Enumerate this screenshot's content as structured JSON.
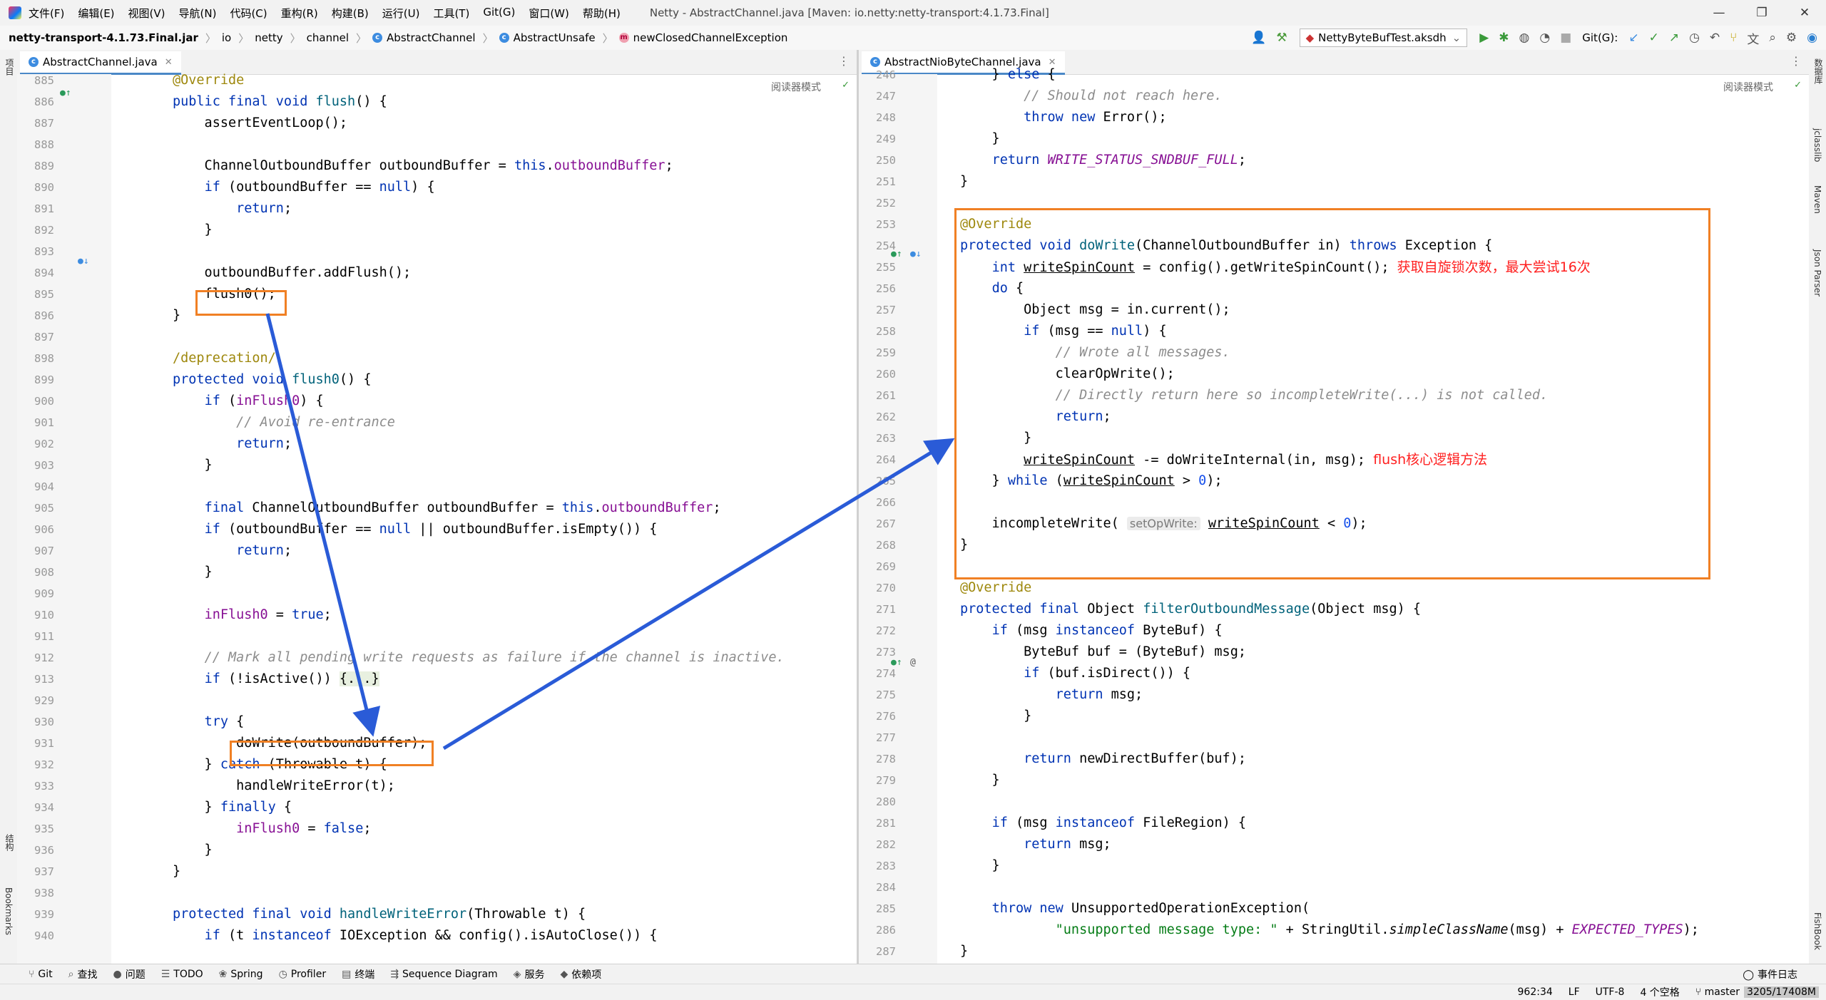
{
  "menu": [
    "文件(F)",
    "编辑(E)",
    "视图(V)",
    "导航(N)",
    "代码(C)",
    "重构(R)",
    "构建(B)",
    "运行(U)",
    "工具(T)",
    "Git(G)",
    "窗口(W)",
    "帮助(H)"
  ],
  "window_title": "Netty - AbstractChannel.java [Maven: io.netty:netty-transport:4.1.73.Final]",
  "window_controls": [
    "—",
    "❐",
    "✕"
  ],
  "breadcrumb": {
    "jar": "netty-transport-4.1.73.Final.jar",
    "pkg1": "io",
    "pkg2": "netty",
    "pkg3": "channel",
    "cls1": "AbstractChannel",
    "cls2": "AbstractUnsafe",
    "method": "newClosedChannelException"
  },
  "toolbar": {
    "run_config": "NettyByteBufTest.aksdh",
    "git_label": "Git(G):"
  },
  "left_strip": [
    "项目",
    "结构",
    "Bookmarks"
  ],
  "right_strip": [
    "数据库",
    "jclasslib",
    "Maven",
    "Json Parser",
    "FishBook"
  ],
  "left_pane": {
    "tab": "AbstractChannel.java",
    "reader_mode": "阅读器模式",
    "lines": [
      {
        "n": "885",
        "h": "<span class=\"an\">@Override</span>"
      },
      {
        "n": "886",
        "h": "<span class=\"kw\">public final void</span> <span style=\"color:#00627a\">flush</span>() {"
      },
      {
        "n": "887",
        "h": "    assertEventLoop();"
      },
      {
        "n": "888",
        "h": ""
      },
      {
        "n": "889",
        "h": "    ChannelOutboundBuffer outboundBuffer = <span class=\"kw\">this</span>.<span class=\"fd\">outboundBuffer</span>;"
      },
      {
        "n": "890",
        "h": "    <span class=\"kw\">if</span> (outboundBuffer == <span class=\"kw\">null</span>) {"
      },
      {
        "n": "891",
        "h": "        <span class=\"kw\">return</span>;"
      },
      {
        "n": "892",
        "h": "    }"
      },
      {
        "n": "893",
        "h": ""
      },
      {
        "n": "894",
        "h": "    outboundBuffer.addFlush();"
      },
      {
        "n": "895",
        "h": "    flush0();"
      },
      {
        "n": "896",
        "h": "}"
      },
      {
        "n": "897",
        "h": ""
      },
      {
        "n": "898",
        "h": "<span class=\"an\">/deprecation/</span>"
      },
      {
        "n": "899",
        "h": "<span class=\"kw\">protected void</span> <span style=\"color:#00627a\">flush0</span>() {"
      },
      {
        "n": "900",
        "h": "    <span class=\"kw\">if</span> (<span class=\"fd\">inFlush0</span>) {"
      },
      {
        "n": "901",
        "h": "        <span class=\"cm\">// Avoid re-entrance</span>"
      },
      {
        "n": "902",
        "h": "        <span class=\"kw\">return</span>;"
      },
      {
        "n": "903",
        "h": "    }"
      },
      {
        "n": "904",
        "h": ""
      },
      {
        "n": "905",
        "h": "    <span class=\"kw\">final</span> ChannelOutboundBuffer outboundBuffer = <span class=\"kw\">this</span>.<span class=\"fd\">outboundBuffer</span>;"
      },
      {
        "n": "906",
        "h": "    <span class=\"kw\">if</span> (outboundBuffer == <span class=\"kw\">null</span> || outboundBuffer.isEmpty()) {"
      },
      {
        "n": "907",
        "h": "        <span class=\"kw\">return</span>;"
      },
      {
        "n": "908",
        "h": "    }"
      },
      {
        "n": "909",
        "h": ""
      },
      {
        "n": "910",
        "h": "    <span class=\"fd\">inFlush0</span> = <span class=\"kw\">true</span>;"
      },
      {
        "n": "911",
        "h": ""
      },
      {
        "n": "912",
        "h": "    <span class=\"cm\">// Mark all pending write requests as failure if the channel is inactive.</span>"
      },
      {
        "n": "913",
        "h": "    <span class=\"kw\">if</span> (!isActive()) <span style=\"background:#e8f0e0\">{...}</span>"
      },
      {
        "n": "929",
        "h": ""
      },
      {
        "n": "930",
        "h": "    <span class=\"kw\">try</span> {"
      },
      {
        "n": "931",
        "h": "        doWrite(outboundBuffer);"
      },
      {
        "n": "932",
        "h": "    } <span class=\"kw\">catch</span> (Throwable t) {"
      },
      {
        "n": "933",
        "h": "        handleWriteError(t);"
      },
      {
        "n": "934",
        "h": "    } <span class=\"kw\">finally</span> {"
      },
      {
        "n": "935",
        "h": "        <span class=\"fd\">inFlush0</span> = <span class=\"kw\">false</span>;"
      },
      {
        "n": "936",
        "h": "    }"
      },
      {
        "n": "937",
        "h": "}"
      },
      {
        "n": "938",
        "h": ""
      },
      {
        "n": "939",
        "h": "<span class=\"kw\">protected final void</span> <span style=\"color:#00627a\">handleWriteError</span>(Throwable t) {"
      },
      {
        "n": "940",
        "h": "    <span class=\"kw\">if</span> (t <span class=\"kw\">instanceof</span> IOException &amp;&amp; config().isAutoClose()) {"
      }
    ]
  },
  "right_pane": {
    "tab": "AbstractNioByteChannel.java",
    "reader_mode": "阅读器模式",
    "lines": [
      {
        "n": "246",
        "h": "    } <span class=\"kw\">else</span> {"
      },
      {
        "n": "247",
        "h": "        <span class=\"cm\">// Should not reach here.</span>"
      },
      {
        "n": "248",
        "h": "        <span class=\"kw\">throw new</span> Error();"
      },
      {
        "n": "249",
        "h": "    }"
      },
      {
        "n": "250",
        "h": "    <span class=\"kw\">return</span> <span class=\"cs\">WRITE_STATUS_SNDBUF_FULL</span>;"
      },
      {
        "n": "251",
        "h": "}"
      },
      {
        "n": "252",
        "h": ""
      },
      {
        "n": "253",
        "h": "<span class=\"an\">@Override</span>"
      },
      {
        "n": "254",
        "h": "<span class=\"kw\">protected void</span> <span style=\"color:#00627a\">doWrite</span>(ChannelOutboundBuffer in) <span class=\"kw\">throws</span> Exception {"
      },
      {
        "n": "255",
        "h": "    <span class=\"kw\">int</span> <span class=\"ul\">writeSpinCount</span> = config().getWriteSpinCount(); <span class=\"red\">获取自旋锁次数，最大尝试16次</span>"
      },
      {
        "n": "256",
        "h": "    <span class=\"kw\">do</span> {"
      },
      {
        "n": "257",
        "h": "        Object msg = in.current();"
      },
      {
        "n": "258",
        "h": "        <span class=\"kw\">if</span> (msg == <span class=\"kw\">null</span>) {"
      },
      {
        "n": "259",
        "h": "            <span class=\"cm\">// Wrote all messages.</span>"
      },
      {
        "n": "260",
        "h": "            clearOpWrite();"
      },
      {
        "n": "261",
        "h": "            <span class=\"cm\">// Directly return here so incompleteWrite(...) is not called.</span>"
      },
      {
        "n": "262",
        "h": "            <span class=\"kw\">return</span>;"
      },
      {
        "n": "263",
        "h": "        }"
      },
      {
        "n": "264",
        "h": "        <span class=\"ul\">writeSpinCount</span> -= doWriteInternal(in, msg); <span class=\"red\">flush核心逻辑方法</span>"
      },
      {
        "n": "265",
        "h": "    } <span class=\"kw\">while</span> (<span class=\"ul\">writeSpinCount</span> &gt; <span class=\"nm\">0</span>);"
      },
      {
        "n": "266",
        "h": ""
      },
      {
        "n": "267",
        "h": "    incompleteWrite( <span class=\"hint\">setOpWrite:</span> <span class=\"ul\">writeSpinCount</span> &lt; <span class=\"nm\">0</span>);"
      },
      {
        "n": "268",
        "h": "}"
      },
      {
        "n": "269",
        "h": ""
      },
      {
        "n": "270",
        "h": "<span class=\"an\">@Override</span>"
      },
      {
        "n": "271",
        "h": "<span class=\"kw\">protected final</span> Object <span style=\"color:#00627a\">filterOutboundMessage</span>(Object msg) {"
      },
      {
        "n": "272",
        "h": "    <span class=\"kw\">if</span> (msg <span class=\"kw\">instanceof</span> ByteBuf) {"
      },
      {
        "n": "273",
        "h": "        ByteBuf buf = (ByteBuf) msg;"
      },
      {
        "n": "274",
        "h": "        <span class=\"kw\">if</span> (buf.isDirect()) {"
      },
      {
        "n": "275",
        "h": "            <span class=\"kw\">return</span> msg;"
      },
      {
        "n": "276",
        "h": "        }"
      },
      {
        "n": "277",
        "h": ""
      },
      {
        "n": "278",
        "h": "        <span class=\"kw\">return</span> newDirectBuffer(buf);"
      },
      {
        "n": "279",
        "h": "    }"
      },
      {
        "n": "280",
        "h": ""
      },
      {
        "n": "281",
        "h": "    <span class=\"kw\">if</span> (msg <span class=\"kw\">instanceof</span> FileRegion) {"
      },
      {
        "n": "282",
        "h": "        <span class=\"kw\">return</span> msg;"
      },
      {
        "n": "283",
        "h": "    }"
      },
      {
        "n": "284",
        "h": ""
      },
      {
        "n": "285",
        "h": "    <span class=\"kw\">throw new</span> UnsupportedOperationException("
      },
      {
        "n": "286",
        "h": "            <span class=\"st\">\"unsupported message type: \"</span> + StringUtil.<span style=\"font-style:italic\">simpleClassName</span>(msg) + <span class=\"cs\">EXPECTED_TYPES</span>);"
      },
      {
        "n": "287",
        "h": "}"
      }
    ]
  },
  "tool_windows": [
    {
      "icon": "⑂",
      "label": "Git"
    },
    {
      "icon": "⌕",
      "label": "查找"
    },
    {
      "icon": "●",
      "label": "问题"
    },
    {
      "icon": "☰",
      "label": "TODO"
    },
    {
      "icon": "❀",
      "label": "Spring"
    },
    {
      "icon": "◷",
      "label": "Profiler"
    },
    {
      "icon": "▤",
      "label": "终端"
    },
    {
      "icon": "⇶",
      "label": "Sequence Diagram"
    },
    {
      "icon": "◈",
      "label": "服务"
    },
    {
      "icon": "◆",
      "label": "依赖项"
    }
  ],
  "event_log": "事件日志",
  "status": {
    "pos": "962:34",
    "lf": "LF",
    "enc": "UTF-8",
    "indent": "4 个空格",
    "branch": "master",
    "mem": "3205/17408M"
  },
  "colors": {
    "highlight_box": "#f08024",
    "arrow": "#2a5bd7",
    "annotation_text": "#ff2020"
  }
}
